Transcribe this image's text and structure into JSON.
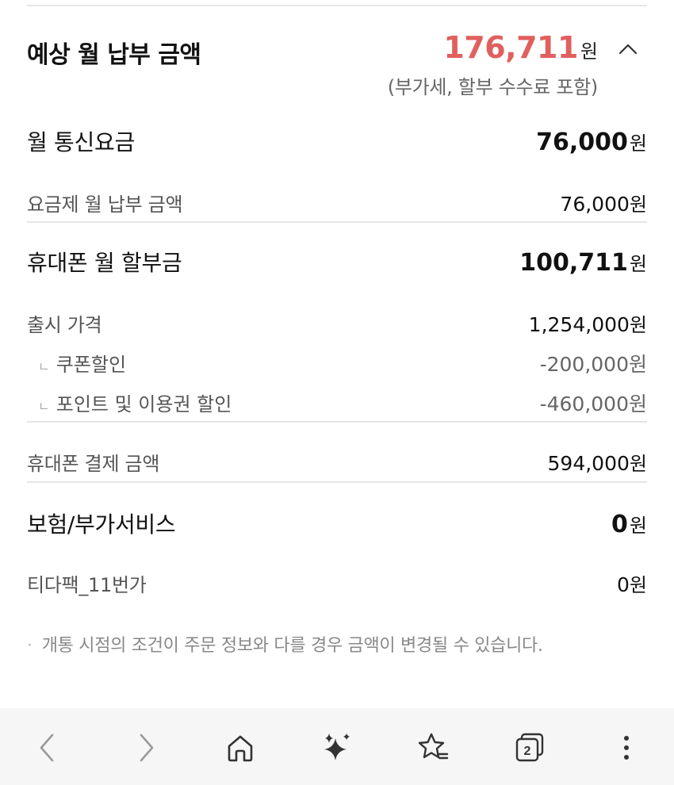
{
  "summary": {
    "title": "예상 월 납부 금액",
    "amount": "176,711",
    "unit": "원",
    "note": "(부가세, 할부 수수료 포함)"
  },
  "rows": {
    "monthly_fee": {
      "label": "월 통신요금",
      "amount": "76,000",
      "unit": "원"
    },
    "plan_fee": {
      "label": "요금제 월 납부 금액",
      "amount": "76,000",
      "unit": "원"
    },
    "installment": {
      "label": "휴대폰 월 할부금",
      "amount": "100,711",
      "unit": "원"
    },
    "release_price": {
      "label": "출시 가격",
      "amount": "1,254,000",
      "unit": "원"
    },
    "coupon_discount": {
      "mark": "ㄴ",
      "label": "쿠폰할인",
      "amount": "-200,000",
      "unit": "원"
    },
    "point_discount": {
      "mark": "ㄴ",
      "label": "포인트 및 이용권 할인",
      "amount": "-460,000",
      "unit": "원"
    },
    "payment_amount": {
      "label": "휴대폰 결제 금액",
      "amount": "594,000",
      "unit": "원"
    },
    "insurance": {
      "label": "보험/부가서비스",
      "amount": "0",
      "unit": "원"
    },
    "tidapack": {
      "label": "티다팩_11번가",
      "amount": "0",
      "unit": "원"
    }
  },
  "footnote": {
    "dot": "·",
    "text": "개통 시점의 조건이 주문 정보와 다를 경우 금액이 변경될 수 있습니다."
  },
  "browser": {
    "tab_count": "2",
    "icons": [
      "back-icon",
      "forward-icon",
      "home-icon",
      "sparkle-icon",
      "bookmark-star-icon",
      "tabs-icon",
      "more-icon"
    ]
  },
  "colors": {
    "accent": "#e0605e",
    "divider": "#e6e6e6",
    "toolbar_bg": "#f6f6f6"
  }
}
